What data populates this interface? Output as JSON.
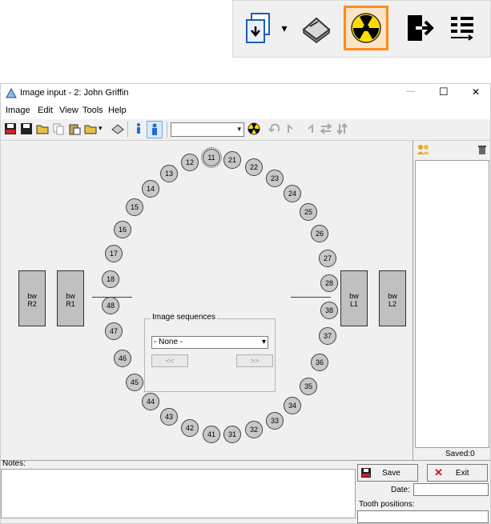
{
  "window": {
    "title": "Image input - 2: John Griffin",
    "controls": [
      "—",
      "☐",
      "✕"
    ]
  },
  "menu": [
    "Image",
    "Edit",
    "View",
    "Tools",
    "Help"
  ],
  "zoomed_toolbar": {
    "icons": [
      "import-icon",
      "dropdown-arrow-icon",
      "scanner-icon",
      "xray-icon",
      "exit-arrow-icon",
      "list-sort-icon"
    ],
    "dropdown_glyph": "▾"
  },
  "toolbar": {
    "combo_value": "",
    "icons": [
      "save-icon",
      "save-as-icon",
      "open-folder-icon",
      "copy-icon",
      "paste-icon",
      "folder-icon",
      "scanner-icon",
      "person-small-icon",
      "person-large-icon",
      "xray-icon",
      "rotate-left-icon",
      "flip-h-icon",
      "flip-v-icon",
      "swap-h-icon",
      "swap-v-icon"
    ]
  },
  "teeth": {
    "upper": [
      "11",
      "12",
      "13",
      "14",
      "15",
      "16",
      "17",
      "18",
      "21",
      "22",
      "23",
      "24",
      "25",
      "26",
      "27",
      "28"
    ],
    "lower": [
      "31",
      "32",
      "33",
      "34",
      "35",
      "36",
      "37",
      "38",
      "41",
      "42",
      "43",
      "44",
      "45",
      "46",
      "47",
      "48"
    ],
    "selected": "11"
  },
  "bitewings": {
    "r2": "bw\nR2",
    "r1": "bw\nR1",
    "l1": "bw\nL1",
    "l2": "bw\nL2"
  },
  "image_sequences": {
    "legend": "Image sequences",
    "selected": "- None -",
    "prev": "<<",
    "next": ">>"
  },
  "right_panel": {
    "saved": "Saved:0"
  },
  "bottom": {
    "notes_label": "Notes:",
    "save_label": "Save",
    "exit_label": "Exit",
    "date_label": "Date:",
    "date_value": "",
    "tooth_positions_label": "Tooth positions:"
  },
  "colors": {
    "xray_highlight": "#ff8c1a",
    "xray_yellow": "#ffdc00",
    "person_blue": "#1e6ed8"
  }
}
